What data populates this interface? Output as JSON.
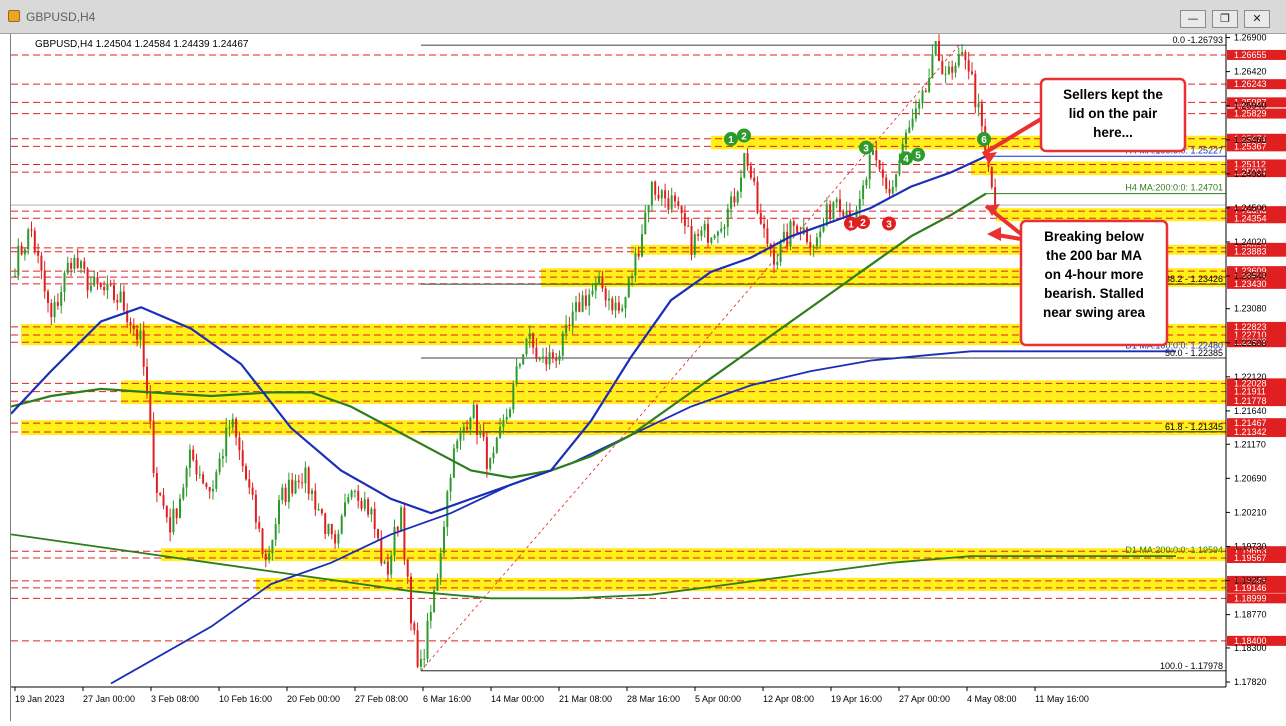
{
  "window": {
    "title": "GBPUSD,H4",
    "minimize_glyph": "—",
    "restore_glyph": "❐",
    "close_glyph": "✕"
  },
  "chart_data": {
    "type": "candlestick",
    "symbol_line": "GBPUSD,H4  1.24504 1.24584 1.24439 1.24467",
    "ylim": [
      1.1775,
      1.2695
    ],
    "y_ticks": [
      "1.26900",
      "1.26420",
      "1.25940",
      "1.25460",
      "1.24980",
      "1.24500",
      "1.24020",
      "1.23540",
      "1.23080",
      "1.22600",
      "1.22120",
      "1.21640",
      "1.21170",
      "1.20690",
      "1.20210",
      "1.19730",
      "1.19250",
      "1.18770",
      "1.18300",
      "1.17820"
    ],
    "x_ticks": [
      "19 Jan 2023",
      "27 Jan 00:00",
      "3 Feb 08:00",
      "10 Feb 16:00",
      "20 Feb 00:00",
      "27 Feb 08:00",
      "6 Mar 16:00",
      "14 Mar 00:00",
      "21 Mar 08:00",
      "28 Mar 16:00",
      "5 Apr 00:00",
      "12 Apr 08:00",
      "19 Apr 16:00",
      "27 Apr 00:00",
      "4 May 08:00",
      "11 May 16:00"
    ],
    "red_level_labels": [
      "1.26655",
      "1.26243",
      "1.25987",
      "1.25829",
      "1.25474",
      "1.25367",
      "1.25112",
      "1.25004",
      "1.24454",
      "1.24354",
      "1.23937",
      "1.23883",
      "1.23609",
      "1.23525",
      "1.23430",
      "1.22823",
      "1.22710",
      "1.22608",
      "1.22028",
      "1.21911",
      "1.21778",
      "1.21467",
      "1.21342",
      "1.19663",
      "1.19567",
      "1.19245",
      "1.19146",
      "1.18999",
      "1.18400"
    ],
    "fib_levels": [
      {
        "label": "0.0 -1.26793",
        "value": 1.26793
      },
      {
        "label": "38.2 - 1.23426",
        "value": 1.23426
      },
      {
        "label": "50.0 - 1.22385",
        "value": 1.22385
      },
      {
        "label": "61.8 - 1.21345",
        "value": 1.21345
      },
      {
        "label": "100.0 - 1.17978",
        "value": 1.17978
      }
    ],
    "ma_labels": [
      {
        "text": "H4 MA:100:0:0: 1.25227",
        "value": 1.25227,
        "color": "#1a2eb8"
      },
      {
        "text": "H4 MA:200:0:0: 1.24701",
        "value": 1.24701,
        "color": "#2e7d1a"
      },
      {
        "text": "D1 MA:100:0:0: 1.22480",
        "value": 1.2248,
        "color": "#1a2eb8"
      },
      {
        "text": "D1 MA:200:0:0: 1.19594",
        "value": 1.19594,
        "color": "#2e7d1a"
      }
    ],
    "yellow_zones": [
      [
        1.25474,
        1.25367
      ],
      [
        1.25112,
        1.25004
      ],
      [
        1.24454,
        1.24354
      ],
      [
        1.23937,
        1.23883
      ],
      [
        1.23609,
        1.2343
      ],
      [
        1.22823,
        1.22608
      ],
      [
        1.22028,
        1.21778
      ],
      [
        1.21467,
        1.21342
      ],
      [
        1.19663,
        1.19567
      ],
      [
        1.19245,
        1.19146
      ]
    ],
    "green_markers": [
      "1",
      "2",
      "3",
      "4",
      "5",
      "6"
    ],
    "red_markers": [
      "1",
      "2",
      "3"
    ],
    "annotations": [
      {
        "lines": [
          "Sellers kept the",
          "lid on the pair",
          "here..."
        ]
      },
      {
        "lines": [
          "Breaking below",
          "the 200 bar MA",
          "on 4-hour more",
          "bearish.  Stalled",
          "near swing area"
        ]
      }
    ],
    "colors": {
      "bull": "#2e9a2e",
      "bear": "#e02020",
      "ma_blue": "#1a2eb8",
      "ma_green": "#2e7d1a",
      "zone": "#ffee00",
      "level": "#e02020",
      "callout_border": "#ea3030",
      "price_line": "#d00000"
    }
  }
}
